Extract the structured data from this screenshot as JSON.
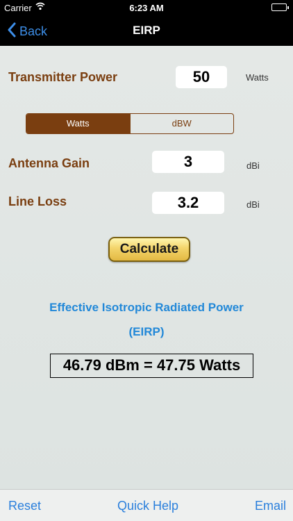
{
  "status_bar": {
    "carrier": "Carrier",
    "time": "6:23 AM",
    "icons": [
      "wifi-icon",
      "battery-icon"
    ]
  },
  "nav": {
    "back_label": "Back",
    "title": "EIRP"
  },
  "form": {
    "transmitter_power": {
      "label": "Transmitter Power",
      "value": "50",
      "unit": "Watts"
    },
    "unit_toggle": {
      "options": [
        "Watts",
        "dBW"
      ],
      "selected": "Watts"
    },
    "antenna_gain": {
      "label": "Antenna Gain",
      "value": "3",
      "unit": "dBi"
    },
    "line_loss": {
      "label": "Line Loss",
      "value": "3.2",
      "unit": "dBi"
    },
    "calculate_label": "Calculate"
  },
  "result": {
    "title_line1": "Effective Isotropic Radiated Power",
    "title_line2": "(EIRP)",
    "value": "46.79 dBm = 47.75 Watts"
  },
  "toolbar": {
    "reset_label": "Reset",
    "help_label": "Quick Help",
    "email_label": "Email"
  },
  "colors": {
    "accent_brown": "#7a3e10",
    "link_blue": "#2a7fdc",
    "result_blue": "#2288d8",
    "button_gold": "#f3d46a"
  }
}
